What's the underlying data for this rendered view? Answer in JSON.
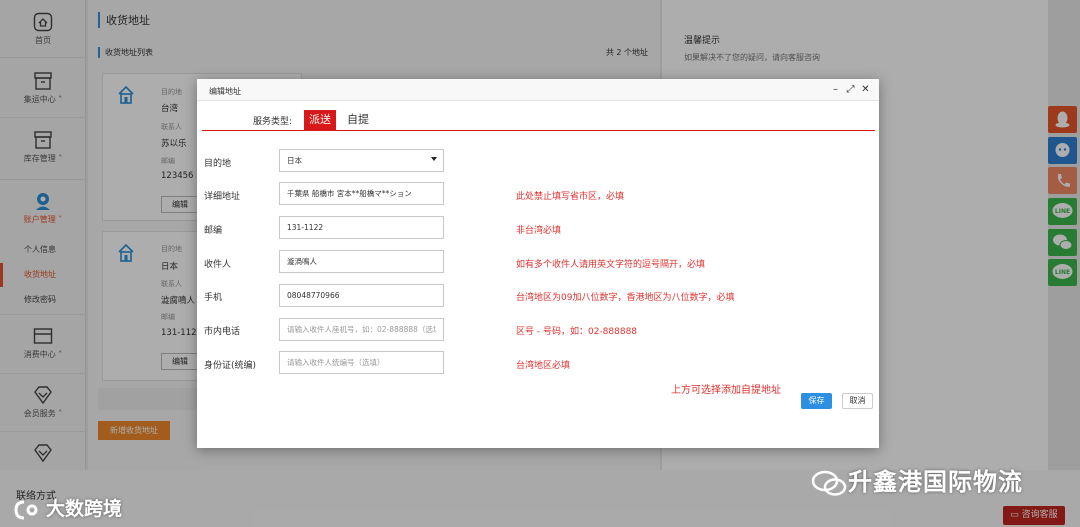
{
  "sidebar": {
    "items": [
      {
        "label": "首页",
        "icon": "home-icon"
      },
      {
        "label": "集运中心",
        "icon": "archive-icon"
      },
      {
        "label": "库存管理",
        "icon": "inventory-icon"
      },
      {
        "label": "账户管理",
        "icon": "user-icon"
      },
      {
        "label": "消费中心",
        "icon": "card-icon"
      },
      {
        "label": "会员服务",
        "icon": "diamond-icon"
      }
    ],
    "sub_items": [
      "个人信息",
      "收货地址",
      "修改密码"
    ]
  },
  "main": {
    "page_title": "收货地址",
    "list_title": "收货地址列表",
    "list_count": "共 2 个地址",
    "add_button": "新增收货地址",
    "cards": [
      {
        "dest_label": "目的地",
        "dest": "台湾",
        "contact_label": "联系人",
        "contact": "苏以乐",
        "zip_label": "邮编",
        "zip": "123456",
        "edit": "编辑"
      },
      {
        "dest_label": "目的地",
        "dest": "日本",
        "contact_label": "联系人",
        "contact": "澁腐鳴人",
        "zip_label": "邮编",
        "zip": "131-1122",
        "edit": "编辑"
      }
    ],
    "contact_section_title": "联络方式"
  },
  "info_panel": {
    "title": "温馨提示",
    "text": "如果解决不了您的疑问，请向客服咨询"
  },
  "modal": {
    "title": "编辑地址",
    "service_label": "服务类型:",
    "service_tabs": [
      "派送",
      "自提"
    ],
    "fields": {
      "destination": {
        "label": "目的地",
        "value": "日本"
      },
      "address": {
        "label": "详细地址",
        "value": "千葉県 船橋市 宮本**船橋マ**ション",
        "hint": "此处禁止填写省市区，必填"
      },
      "zip": {
        "label": "邮编",
        "value": "131-1122",
        "hint": "非台湾必填"
      },
      "recipient": {
        "label": "收件人",
        "value": "漩渦鳴人",
        "hint": "如有多个收件人请用英文字符的逗号隔开，必填"
      },
      "mobile": {
        "label": "手机",
        "value": "08048770966",
        "hint": "台湾地区为09加八位数字，香港地区为八位数字，必填"
      },
      "phone": {
        "label": "市内电话",
        "placeholder": "请输入收件人座机号，如：02-888888（选填）",
        "hint": "区号 - 号码，如：02-888888"
      },
      "id_card": {
        "label": "身份证(统编)",
        "placeholder": "请输入收件人统编号（选填）",
        "hint": "台湾地区必填"
      }
    },
    "pickup_hint": "上方可选择添加自提地址",
    "save": "保存",
    "cancel": "取消"
  },
  "chat_button": "咨询客服",
  "watermarks": {
    "left": "大数跨境",
    "right": "升鑫港国际物流"
  },
  "colors": {
    "accent": "#d71a19",
    "brand_orange": "#ef8a2d",
    "blue": "#2d8fe3",
    "hint_red": "#e0312f"
  }
}
